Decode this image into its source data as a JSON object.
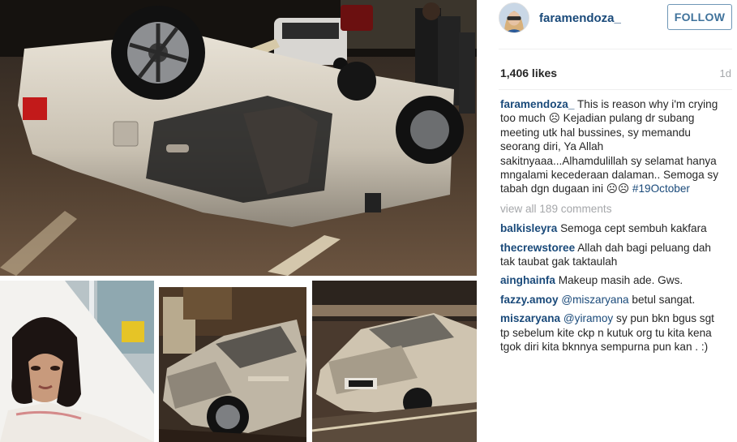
{
  "post": {
    "username": "faramendoza_",
    "follow_label": "FOLLOW",
    "likes": "1,406 likes",
    "age": "1d",
    "caption_user": "faramendoza_",
    "caption_text": "This is reason why i'm crying too much ☹ Kejadian pulang dr subang meeting utk hal bussines, sy memandu seorang diri, Ya Allah sakitnyaaa...Alhamdulillah sy selamat hanya mngalami kecederaan dalaman.. Semoga sy tabah dgn dugaan ini ☹☹",
    "caption_hashtag": "#19October",
    "view_all": "view all 189 comments"
  },
  "comments": [
    {
      "user": "balkisleyra",
      "mention": "",
      "text": "Semoga cept sembuh kakfara"
    },
    {
      "user": "thecrewstoree",
      "mention": "",
      "text": "Allah dah bagi peluang dah tak taubat gak taktaulah"
    },
    {
      "user": "ainghainfa",
      "mention": "",
      "text": "Makeup masih ade. Gws."
    },
    {
      "user": "fazzy.amoy",
      "mention": "@miszaryana",
      "text": "betul sangat."
    },
    {
      "user": "miszaryana",
      "mention": "@yiramoy",
      "text": "sy pun bkn bgus sgt tp sebelum kite ckp n kutuk org tu kita kena tgok diri kita bknnya sempurna pun kan . :)"
    }
  ],
  "icons": {
    "avatar": "profile-avatar",
    "crying_emoji": "frowning-face"
  },
  "colors": {
    "link": "#1a4a7a",
    "follow_border": "#6f97b6",
    "follow_text": "#3f729b",
    "muted": "#a5a7aa"
  }
}
